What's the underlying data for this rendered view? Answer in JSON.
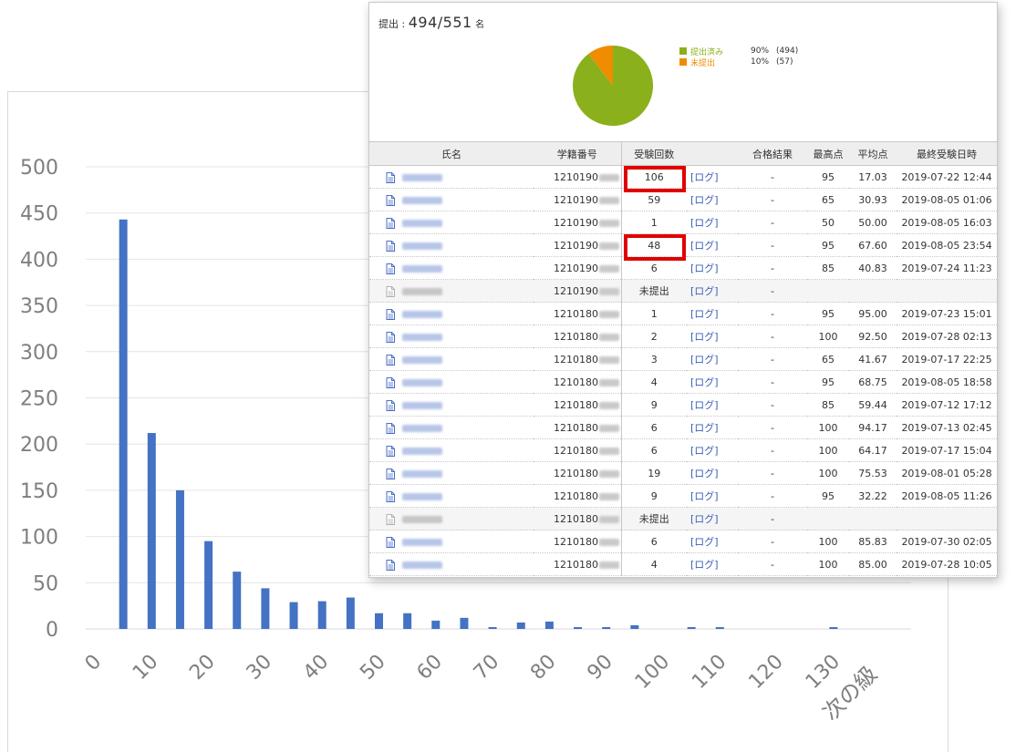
{
  "chart_data": {
    "type": "bar",
    "xlabel": "",
    "ylabel": "",
    "ylim": [
      0,
      500
    ],
    "yticks": [
      0,
      50,
      100,
      150,
      200,
      250,
      300,
      350,
      400,
      450,
      500
    ],
    "xticks": [
      "0",
      "10",
      "20",
      "30",
      "40",
      "50",
      "60",
      "70",
      "80",
      "90",
      "100",
      "110",
      "120",
      "130",
      "次の級"
    ],
    "categories": [
      5,
      10,
      15,
      20,
      25,
      30,
      35,
      40,
      45,
      50,
      55,
      60,
      65,
      70,
      75,
      80,
      85,
      90,
      95,
      100,
      105,
      110,
      115,
      120,
      125,
      130,
      135
    ],
    "values": [
      443,
      212,
      150,
      95,
      62,
      44,
      29,
      30,
      34,
      17,
      17,
      9,
      12,
      2,
      7,
      8,
      2,
      2,
      4,
      0,
      2,
      2,
      0,
      0,
      0,
      2,
      0
    ],
    "grid": true,
    "bar_color": "#4472c4"
  },
  "panel": {
    "summary_label": "提出 :",
    "summary_count": "494/551",
    "summary_unit": "名",
    "pie": {
      "submitted": {
        "label": "提出済み",
        "percent": "90%",
        "count": "(494)",
        "color": "#8ab01c",
        "value": 494
      },
      "not_submitted": {
        "label": "未提出",
        "percent": "10%",
        "count": "(57)",
        "color": "#f08c00",
        "value": 57
      }
    },
    "table": {
      "headers": {
        "name": "氏名",
        "student_id": "学籍番号",
        "attempts": "受験回数",
        "result": "合格結果",
        "max": "最高点",
        "avg": "平均点",
        "last": "最終受験日時"
      },
      "rows": [
        {
          "id": "1210190",
          "count": "106",
          "log": "[ログ]",
          "result": "-",
          "max": "95",
          "avg": "17.03",
          "last": "2019-07-22 12:44",
          "submitted": true
        },
        {
          "id": "1210190",
          "count": "59",
          "log": "[ログ]",
          "result": "-",
          "max": "65",
          "avg": "30.93",
          "last": "2019-08-05 01:06",
          "submitted": true
        },
        {
          "id": "1210190",
          "count": "1",
          "log": "[ログ]",
          "result": "-",
          "max": "50",
          "avg": "50.00",
          "last": "2019-08-05 16:03",
          "submitted": true
        },
        {
          "id": "1210190",
          "count": "48",
          "log": "[ログ]",
          "result": "-",
          "max": "95",
          "avg": "67.60",
          "last": "2019-08-05 23:54",
          "submitted": true
        },
        {
          "id": "1210190",
          "count": "6",
          "log": "[ログ]",
          "result": "-",
          "max": "85",
          "avg": "40.83",
          "last": "2019-07-24 11:23",
          "submitted": true
        },
        {
          "id": "1210190",
          "count": "未提出",
          "log": "[ログ]",
          "result": "-",
          "max": "",
          "avg": "",
          "last": "",
          "submitted": false
        },
        {
          "id": "1210180",
          "count": "1",
          "log": "[ログ]",
          "result": "-",
          "max": "95",
          "avg": "95.00",
          "last": "2019-07-23 15:01",
          "submitted": true
        },
        {
          "id": "1210180",
          "count": "2",
          "log": "[ログ]",
          "result": "-",
          "max": "100",
          "avg": "92.50",
          "last": "2019-07-28 02:13",
          "submitted": true
        },
        {
          "id": "1210180",
          "count": "3",
          "log": "[ログ]",
          "result": "-",
          "max": "65",
          "avg": "41.67",
          "last": "2019-07-17 22:25",
          "submitted": true
        },
        {
          "id": "1210180",
          "count": "4",
          "log": "[ログ]",
          "result": "-",
          "max": "95",
          "avg": "68.75",
          "last": "2019-08-05 18:58",
          "submitted": true
        },
        {
          "id": "1210180",
          "count": "9",
          "log": "[ログ]",
          "result": "-",
          "max": "85",
          "avg": "59.44",
          "last": "2019-07-12 17:12",
          "submitted": true
        },
        {
          "id": "1210180",
          "count": "6",
          "log": "[ログ]",
          "result": "-",
          "max": "100",
          "avg": "94.17",
          "last": "2019-07-13 02:45",
          "submitted": true
        },
        {
          "id": "1210180",
          "count": "6",
          "log": "[ログ]",
          "result": "-",
          "max": "100",
          "avg": "64.17",
          "last": "2019-07-17 15:04",
          "submitted": true
        },
        {
          "id": "1210180",
          "count": "19",
          "log": "[ログ]",
          "result": "-",
          "max": "100",
          "avg": "75.53",
          "last": "2019-08-01 05:28",
          "submitted": true
        },
        {
          "id": "1210180",
          "count": "9",
          "log": "[ログ]",
          "result": "-",
          "max": "95",
          "avg": "32.22",
          "last": "2019-08-05 11:26",
          "submitted": true
        },
        {
          "id": "1210180",
          "count": "未提出",
          "log": "[ログ]",
          "result": "-",
          "max": "",
          "avg": "",
          "last": "",
          "submitted": false
        },
        {
          "id": "1210180",
          "count": "6",
          "log": "[ログ]",
          "result": "-",
          "max": "100",
          "avg": "85.83",
          "last": "2019-07-30 02:05",
          "submitted": true
        },
        {
          "id": "1210180",
          "count": "4",
          "log": "[ログ]",
          "result": "-",
          "max": "100",
          "avg": "85.00",
          "last": "2019-07-28 10:05",
          "submitted": true
        }
      ],
      "highlighted_rows": [
        0,
        3
      ],
      "highlight_color": "#e00000",
      "link_color": "#3a5fb5"
    }
  }
}
